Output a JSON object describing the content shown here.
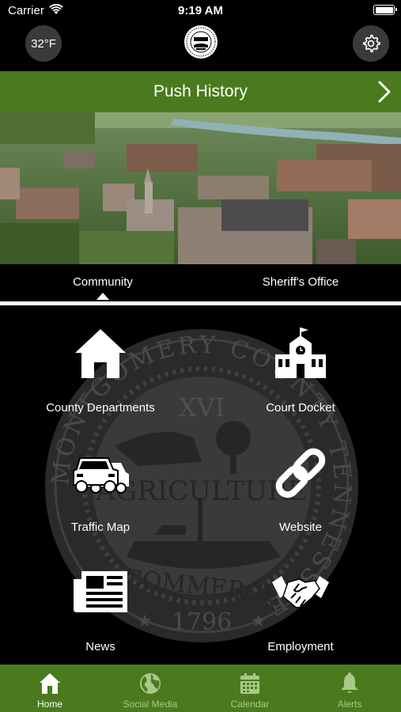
{
  "status_bar": {
    "carrier": "Carrier",
    "time": "9:19 AM",
    "battery_level": 1.0
  },
  "header": {
    "temperature": "32°F",
    "logo": "county-seal",
    "settings_icon": "gear-icon"
  },
  "push_banner": {
    "label": "Push History",
    "icon": "chevron-right-icon"
  },
  "hero": {
    "image": "aerial-city-photo"
  },
  "tabs": [
    {
      "label": "Community",
      "selected": true
    },
    {
      "label": "Sheriff's Office",
      "selected": false
    }
  ],
  "grid": {
    "tiles": [
      {
        "label": "County Departments",
        "icon": "house-icon"
      },
      {
        "label": "Court Docket",
        "icon": "courthouse-icon"
      },
      {
        "label": "Traffic Map",
        "icon": "cars-icon"
      },
      {
        "label": "Website",
        "icon": "link-icon"
      },
      {
        "label": "News",
        "icon": "newspaper-icon"
      },
      {
        "label": "Employment",
        "icon": "handshake-icon"
      }
    ],
    "background_seal": {
      "ring_text": "MONTGOMERY COUNTY TENNESSEE",
      "numeral": "XVI",
      "top_word": "AGRICULTURE",
      "bottom_word": "COMMERCE",
      "year": "1796"
    }
  },
  "tabbar": [
    {
      "label": "Home",
      "icon": "home-icon",
      "active": true
    },
    {
      "label": "Social Media",
      "icon": "globe-icon",
      "active": false
    },
    {
      "label": "Calendar",
      "icon": "calendar-icon",
      "active": false
    },
    {
      "label": "Alerts",
      "icon": "bell-icon",
      "active": false
    }
  ],
  "colors": {
    "brand_green": "#4a7a1d",
    "background": "#000000",
    "button_gray": "#3a3a3a"
  }
}
